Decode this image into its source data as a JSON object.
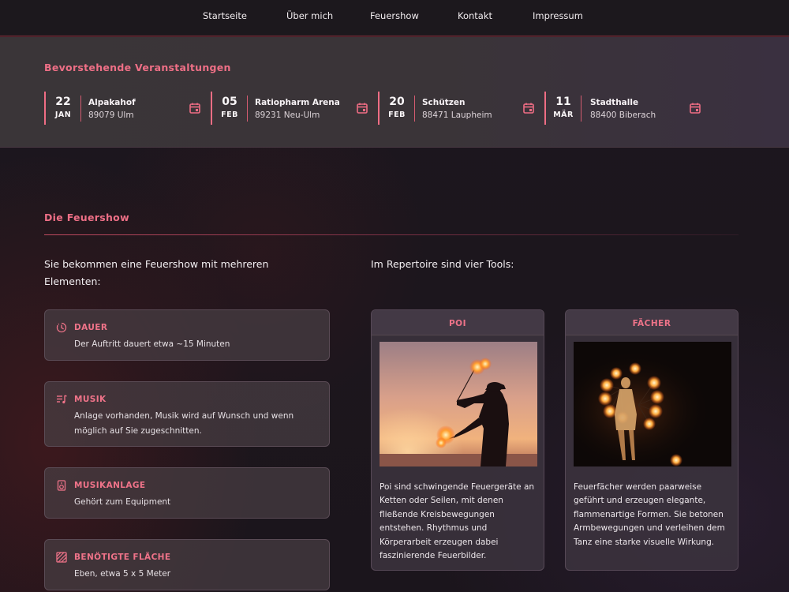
{
  "nav": {
    "items": [
      "Startseite",
      "Über mich",
      "Feuershow",
      "Kontakt",
      "Impressum"
    ]
  },
  "events": {
    "title": "Bevorstehende Veranstaltungen",
    "items": [
      {
        "day": "22",
        "month": "JAN",
        "venue": "Alpakahof",
        "address": "89079 Ulm",
        "icon": "calendar-icon"
      },
      {
        "day": "05",
        "month": "FEB",
        "venue": "Ratiopharm Arena",
        "address": "89231 Neu-Ulm",
        "icon": "calendar-icon"
      },
      {
        "day": "20",
        "month": "FEB",
        "venue": "Schützen",
        "address": "88471 Laupheim",
        "icon": "calendar-icon"
      },
      {
        "day": "11",
        "month": "MÄR",
        "venue": "Stadthalle",
        "address": "88400 Biberach",
        "icon": "calendar-icon"
      }
    ]
  },
  "show": {
    "title": "Die Feuershow",
    "intro_left": "Sie bekommen eine Feuershow mit mehreren Elementen:",
    "intro_right": "Im Repertoire sind vier Tools:",
    "details": [
      {
        "icon": "timer-icon",
        "title": "DAUER",
        "text": "Der Auftritt dauert etwa ~15 Minuten"
      },
      {
        "icon": "music-list-icon",
        "title": "MUSIK",
        "text": "Anlage vorhanden, Musik wird auf Wunsch und wenn möglich auf Sie zugeschnitten."
      },
      {
        "icon": "speaker-icon",
        "title": "MUSIKANLAGE",
        "text": "Gehört zum Equipment"
      },
      {
        "icon": "area-pattern-icon",
        "title": "BENÖTIGTE FLÄCHE",
        "text": "Eben, etwa 5 x 5 Meter"
      }
    ],
    "tools": [
      {
        "title": "POI",
        "image": "poi-fire-performer-photo",
        "text": "Poi sind schwingende Feuergeräte an Ketten oder Seilen, mit denen fließende Kreisbewegungen entstehen. Rhythmus und Körperarbeit erzeugen dabei faszinierende Feuerbilder."
      },
      {
        "title": "FÄCHER",
        "image": "fire-fans-performer-photo",
        "text": "Feuerfächer werden paarweise geführt und erzeugen elegante, flammenartige Formen. Sie betonen Armbewegungen und verleihen dem Tanz eine starke visuelle Wirkung."
      }
    ]
  },
  "colors": {
    "accent": "#ee6f86",
    "background": "#1b151c",
    "band": "#3a3538"
  }
}
